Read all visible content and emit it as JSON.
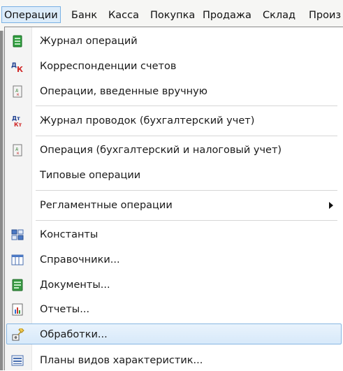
{
  "menubar": {
    "items": [
      "Операции",
      "Банк",
      "Касса",
      "Покупка",
      "Продажа",
      "Склад",
      "Произ"
    ]
  },
  "menu": {
    "items": [
      {
        "label": "Журнал операций",
        "icon": "journal-green-icon"
      },
      {
        "label": "Корреспонденции счетов",
        "icon": "dk-correspondence-icon"
      },
      {
        "label": "Операции, введенные вручную",
        "icon": "manual-operation-icon"
      },
      {
        "label": "Журнал проводок (бухгалтерский учет)",
        "icon": "dt-kt-icon"
      },
      {
        "label": "Операция (бухгалтерский и налоговый учет)",
        "icon": "operation-doc-icon"
      },
      {
        "label": "Типовые операции",
        "icon": ""
      },
      {
        "label": "Регламентные операции",
        "icon": "",
        "submenu": true
      },
      {
        "label": "Константы",
        "icon": "constants-icon"
      },
      {
        "label": "Справочники...",
        "icon": "catalogs-icon"
      },
      {
        "label": "Документы...",
        "icon": "documents-icon"
      },
      {
        "label": "Отчеты...",
        "icon": "reports-icon"
      },
      {
        "label": "Обработки...",
        "icon": "processing-icon",
        "highlighted": true
      },
      {
        "label": "Планы видов характеристик...",
        "icon": "characteristics-plans-icon"
      }
    ]
  },
  "colors": {
    "highlight_bg": "#d7e9fa",
    "highlight_border": "#88b6e2",
    "menubar_bg": "#f6f6f4"
  }
}
